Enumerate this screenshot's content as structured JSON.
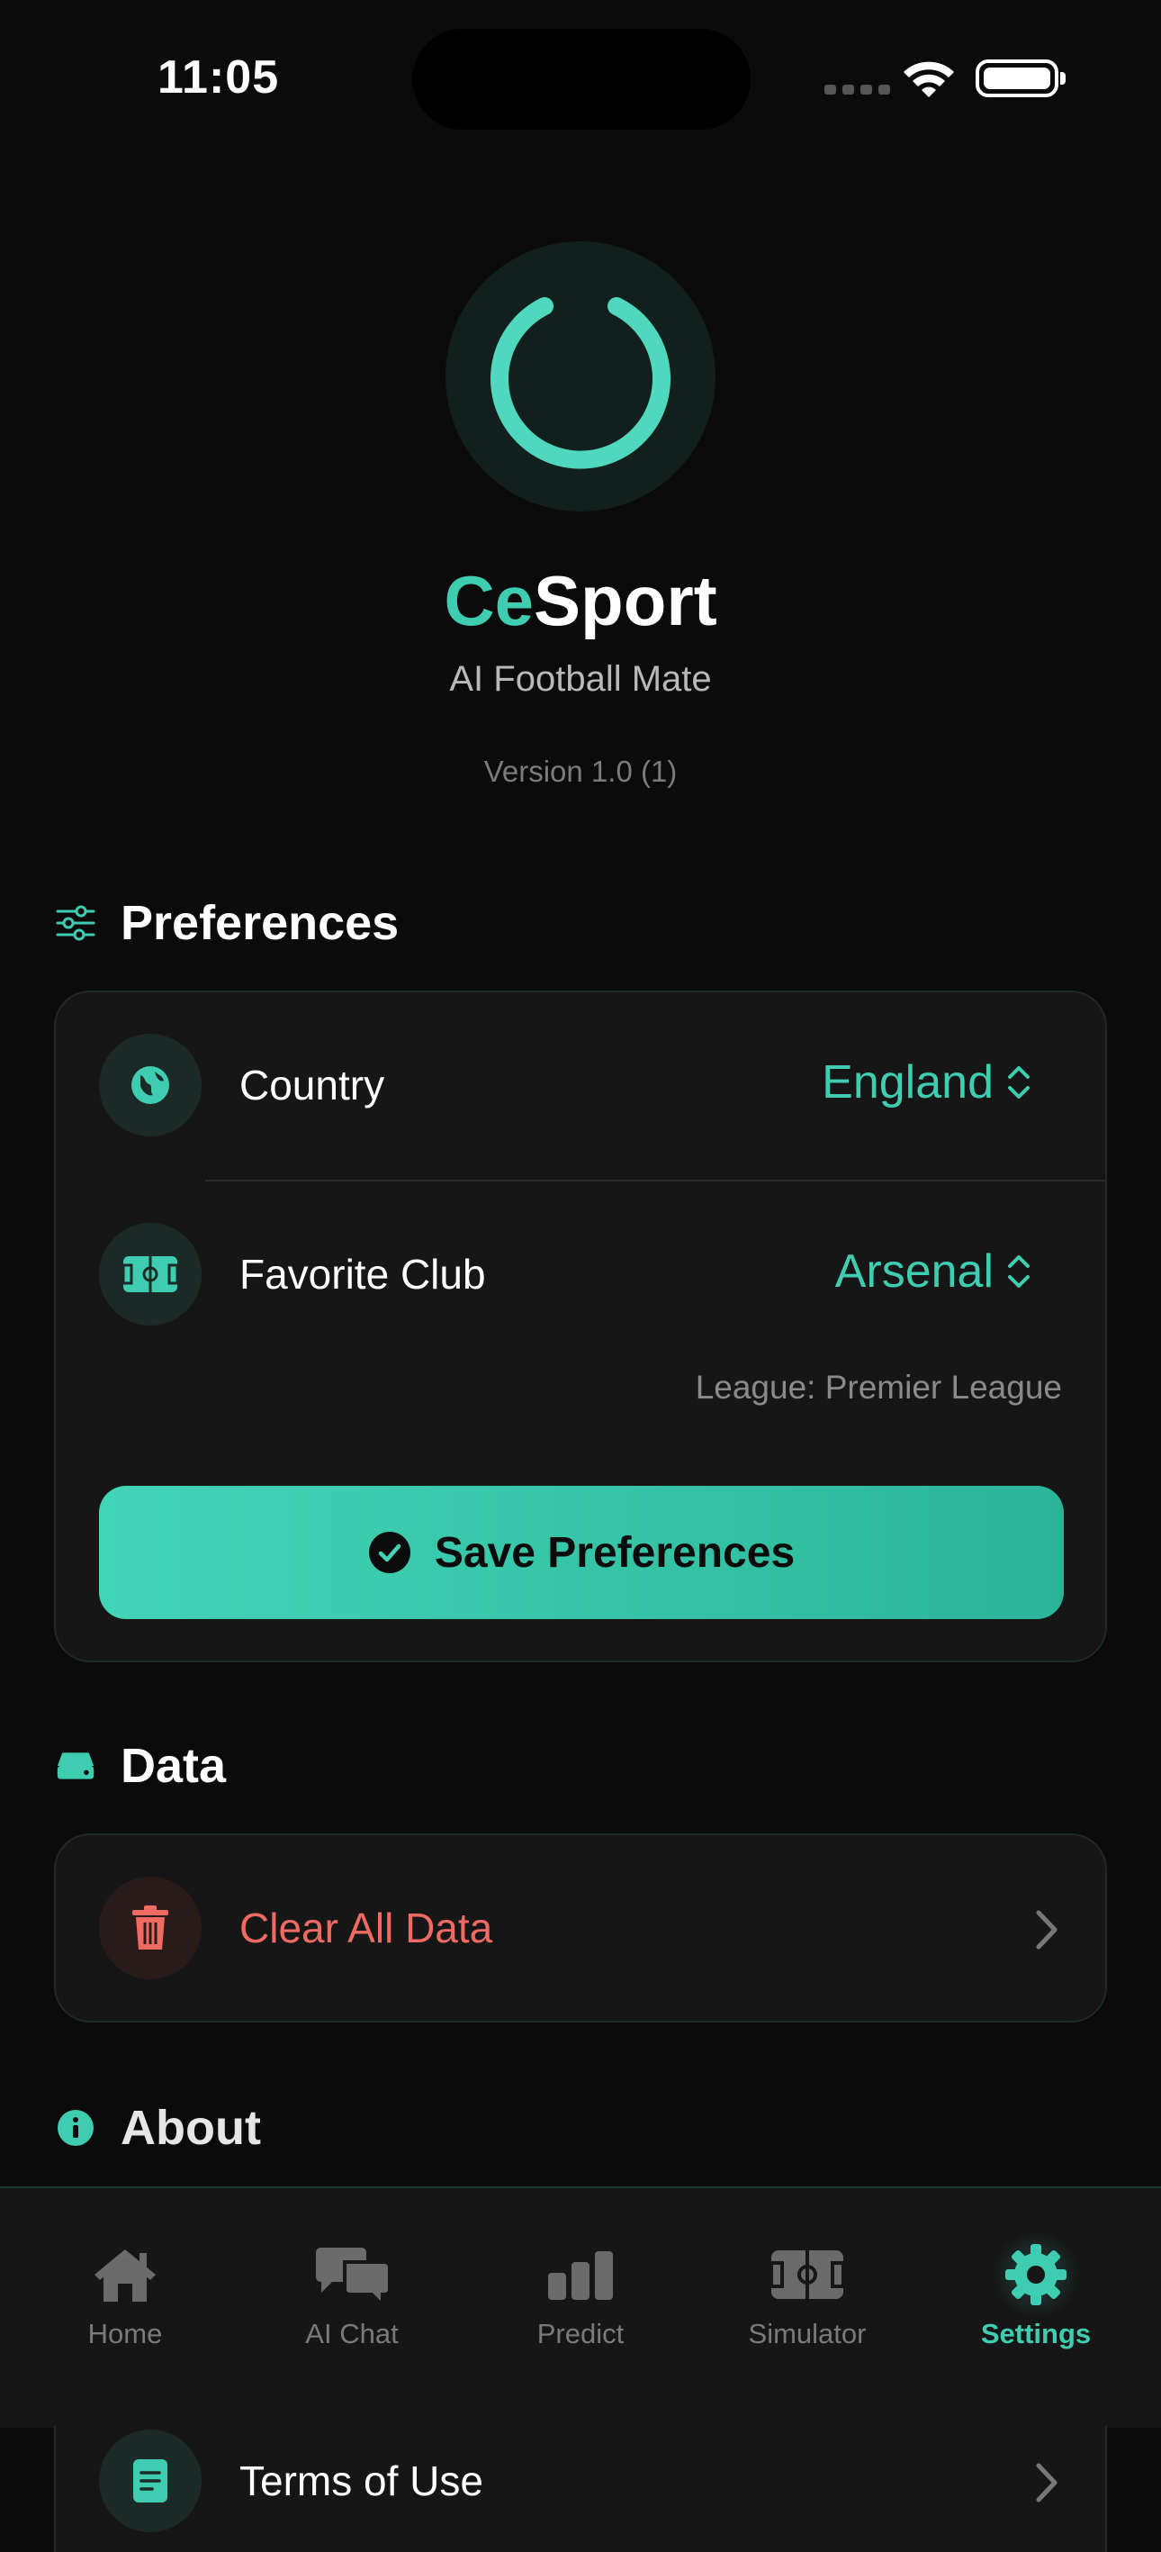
{
  "status_bar": {
    "time": "11:05"
  },
  "header": {
    "app_name_accent": "Ce",
    "app_name_rest": "Sport",
    "tagline": "AI Football Mate",
    "version": "Version 1.0 (1)"
  },
  "preferences": {
    "title": "Preferences",
    "country_label": "Country",
    "country_value": "England",
    "club_label": "Favorite Club",
    "club_value": "Arsenal",
    "league_text": "League: Premier League",
    "save_label": "Save Preferences"
  },
  "data_section": {
    "title": "Data",
    "clear_label": "Clear All Data"
  },
  "about_section": {
    "title": "About",
    "terms_label": "Terms of Use"
  },
  "tabbar": {
    "items": [
      {
        "label": "Home"
      },
      {
        "label": "AI Chat"
      },
      {
        "label": "Predict"
      },
      {
        "label": "Simulator"
      },
      {
        "label": "Settings"
      }
    ],
    "active": "Settings"
  },
  "colors": {
    "accent": "#3ecdb0",
    "danger": "#ef6a63",
    "background": "#0b0b0b",
    "card": "#161616"
  }
}
